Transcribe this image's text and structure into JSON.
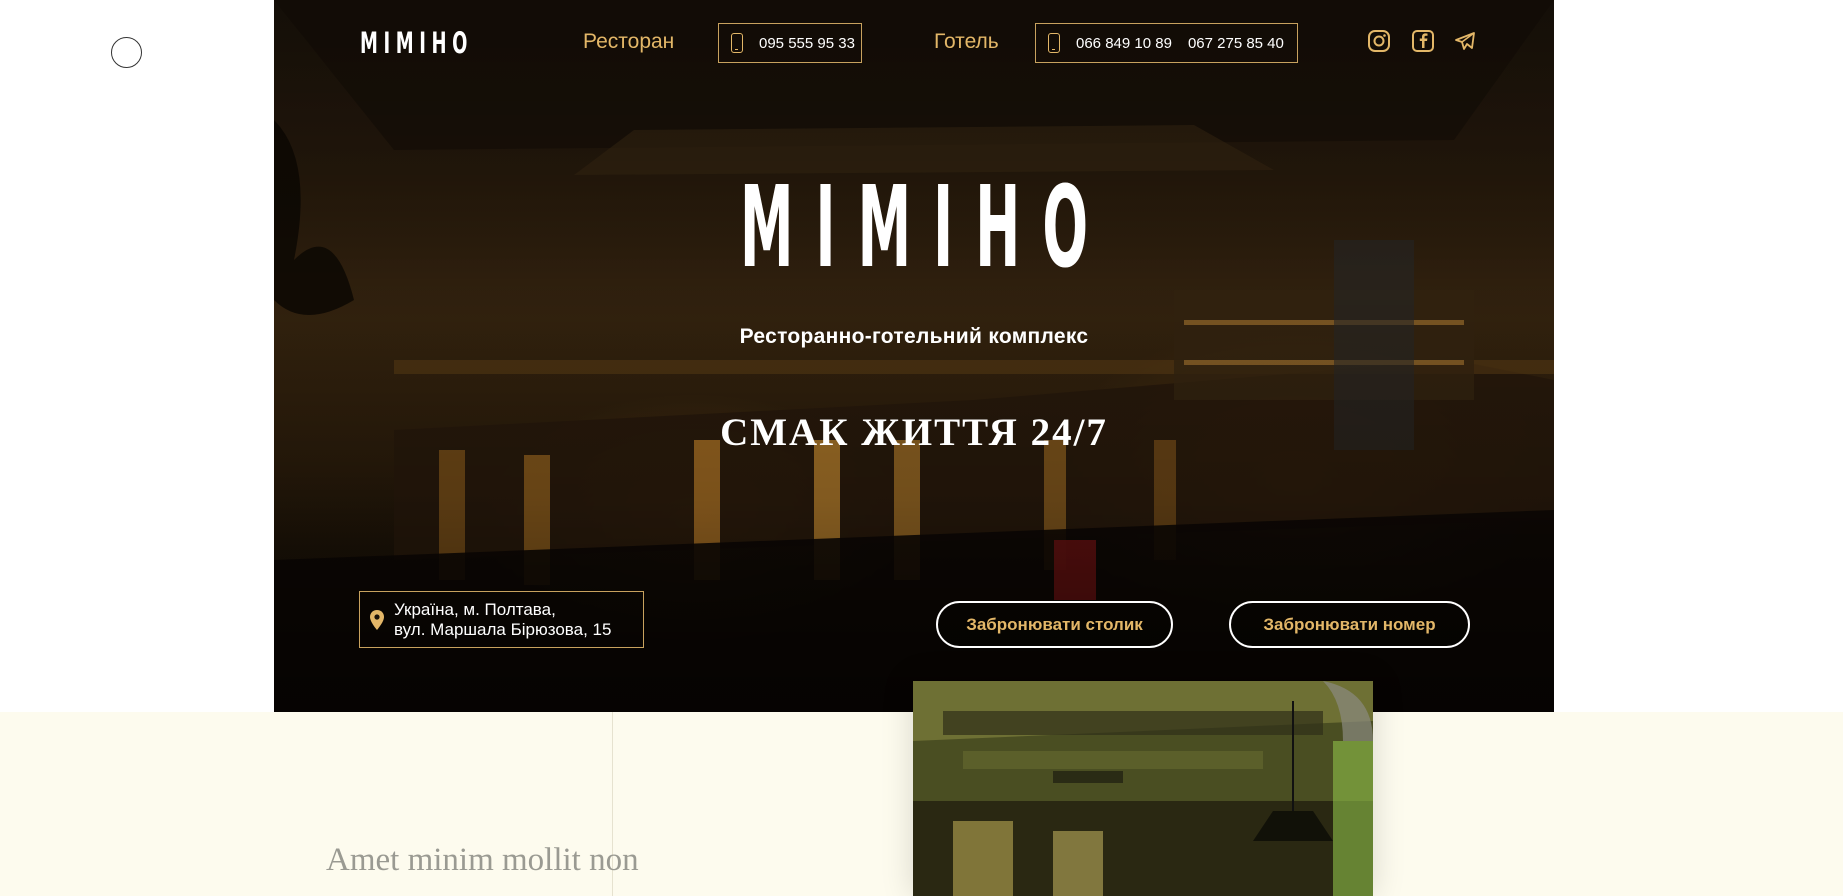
{
  "brand": {
    "logo_text": "МІМІНО"
  },
  "nav": {
    "restaurant_label": "Ресторан",
    "restaurant_phone": "095 555 95 33",
    "hotel_label": "Готель",
    "hotel_phones": [
      "066 849 10 89",
      "067 275 85 40"
    ]
  },
  "social": [
    "instagram-icon",
    "facebook-icon",
    "telegram-icon"
  ],
  "hero": {
    "logo_text": "МІМІНО",
    "subtitle": "Ресторанно-готельний комплекс",
    "slogan": "СМАК ЖИТТЯ 24/7"
  },
  "address": {
    "line1": "Україна, м. Полтава,",
    "line2": "вул. Маршала Бірюзова, 15"
  },
  "actions": {
    "book_table": "Забронювати столик",
    "book_room": "Забронювати номер"
  },
  "section": {
    "heading": "Amet minim mollit non"
  },
  "colors": {
    "accent": "#e3b768",
    "cream": "#fdfbee",
    "hero_dark": "#1f160c"
  }
}
